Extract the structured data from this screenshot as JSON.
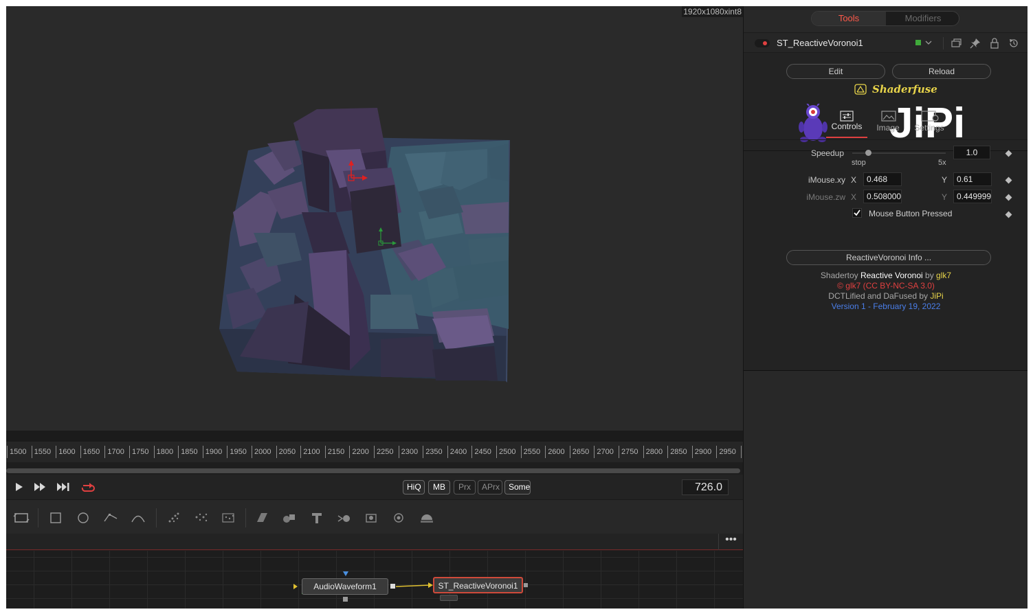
{
  "viewer": {
    "resolution": "1920x1080xint8"
  },
  "timeline": {
    "ticks": [
      "1500",
      "1550",
      "1600",
      "1650",
      "1700",
      "1750",
      "1800",
      "1850",
      "1900",
      "1950",
      "2000",
      "2050",
      "2100",
      "2150",
      "2200",
      "2250",
      "2300",
      "2350",
      "2400",
      "2450",
      "2500",
      "2550",
      "2600",
      "2650",
      "2700",
      "2750",
      "2800",
      "2850",
      "2900",
      "2950"
    ],
    "current_frame": "726.0"
  },
  "transport": {
    "quality_buttons": [
      "HiQ",
      "MB",
      "Prx",
      "APrx",
      "Some"
    ],
    "active_quality": [
      "HiQ",
      "MB",
      "Some"
    ]
  },
  "toolbar": {
    "icons": [
      "background-icon",
      "rectangle-mask-icon",
      "ellipse-mask-icon",
      "polygon-mask-icon",
      "bspline-mask-icon",
      "particle-emitter-icon",
      "particle-render-icon",
      "particle-pixel-icon",
      "image-plane-3d-icon",
      "shape-3d-icon",
      "text-3d-icon",
      "merge-3d-icon",
      "camera-3d-icon",
      "renderer-3d-icon",
      "fog-3d-icon"
    ]
  },
  "nodes": {
    "more_label": "•••",
    "audio": "AudioWaveform1",
    "shader": "ST_ReactiveVoronoi1"
  },
  "inspector": {
    "tabs": {
      "tools": "Tools",
      "modifiers": "Modifiers"
    },
    "tool_name": "ST_ReactiveVoronoi1",
    "edit_label": "Edit",
    "reload_label": "Reload",
    "brand": "Shaderfuse",
    "logo_text": "JiPi",
    "subtabs": {
      "controls": "Controls",
      "image": "Image",
      "settings": "Settings"
    },
    "speedup": {
      "label": "Speedup",
      "value": "1.0",
      "min_label": "stop",
      "max_label": "5x",
      "fraction": 0.17
    },
    "imouse_xy": {
      "label": "iMouse.xy",
      "x_label": "X",
      "x": "0.468",
      "y_label": "Y",
      "y": "0.61"
    },
    "imouse_zw": {
      "label": "iMouse.zw",
      "x_label": "X",
      "x": "0.508000",
      "y_label": "Y",
      "y": "0.449999"
    },
    "mouse_pressed": {
      "label": "Mouse Button Pressed",
      "checked": true
    },
    "info_button": "ReactiveVoronoi Info ...",
    "credits": {
      "l1_a": "Shadertoy ",
      "l1_b": "Reactive Voronoi",
      "l1_c": " by ",
      "l1_d": "glk7",
      "l2": "© glk7 (CC BY-NC-SA 3.0)",
      "l3_a": "DCTLified and DaFused by ",
      "l3_b": "JiPi",
      "l4": "Version 1 - February 19, 2022"
    }
  },
  "colors": {
    "accent_red": "#e04040",
    "link_yellow": "#e8d44a",
    "link_blue": "#4a7ee8",
    "tab_active": "#ff5a4a"
  }
}
